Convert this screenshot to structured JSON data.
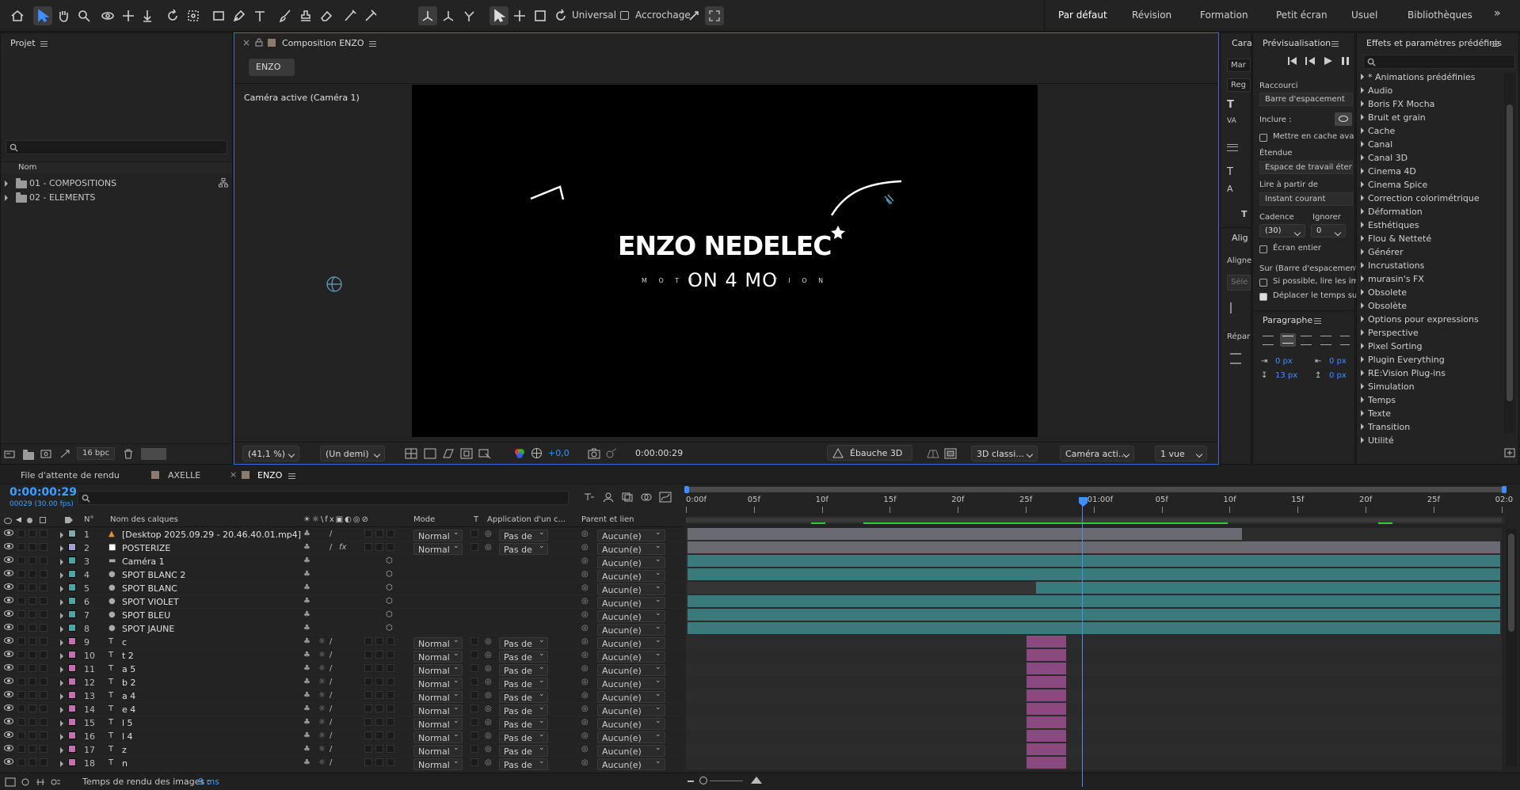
{
  "toolbar": {
    "universal_label": "Universal",
    "snapping_label": "Accrochage",
    "workspaces": [
      "Par défaut",
      "Révision",
      "Formation",
      "Petit écran",
      "Usuel",
      "Bibliothèques"
    ],
    "more": "»"
  },
  "project": {
    "title": "Projet",
    "col_name": "Nom",
    "items": [
      {
        "label": "01 - COMPOSITIONS"
      },
      {
        "label": "02 - ELEMENTS"
      }
    ],
    "bpc": "16 bpc"
  },
  "composition": {
    "close": "×",
    "tab_label": "Composition ENZO",
    "comp_button": "ENZO",
    "camera_label": "Caméra active (Caméra 1)",
    "title_text": "ENZO NEDELEC",
    "subtitle_text": "ON 4 MO",
    "sub_left": "M O T I",
    "sub_right": "T I O N",
    "zoom": "(41,1 %)",
    "resolution": "(Un demi)",
    "exposure": "+0,0",
    "timecode": "0:00:00:29",
    "draft3d": "Ébauche 3D",
    "renderer": "3D classi...",
    "camera_select": "Caméra acti...",
    "views": "1 vue"
  },
  "character_panel": {
    "title": "Cara",
    "font_hint": "Mar",
    "style_hint": "Reg",
    "align_title": "Alig",
    "align_label": "Aligne",
    "select_hint": "Séle",
    "distribute": "Répar"
  },
  "preview": {
    "title": "Prévisualisation",
    "shortcut_label": "Raccourci",
    "shortcut_value": "Barre d'espacement",
    "include_label": "Inclure :",
    "cache_label": "Mettre en cache ava",
    "range_label": "Étendue",
    "range_value": "Espace de travail étend",
    "play_from_label": "Lire à partir de",
    "play_from_value": "Instant courant",
    "framerate_label": "Cadence",
    "skip_label": "Ignorer",
    "framerate_value": "(30)",
    "skip_value": "0",
    "fullscreen_label": "Écran entier",
    "on_label": "Sur (Barre d'espacement",
    "opt1": "Si possible, lire les im",
    "opt2": "Déplacer le temps su",
    "paragraph_title": "Paragraphe",
    "indent_left": "0 px",
    "indent_right": "0 px",
    "space_before": "13 px",
    "space_after": "0 px"
  },
  "effects": {
    "title": "Effets et paramètres prédéfinis",
    "items": [
      "* Animations prédéfinies",
      "Audio",
      "Boris FX Mocha",
      "Bruit et grain",
      "Cache",
      "Canal",
      "Canal 3D",
      "Cinema 4D",
      "Cinema Spice",
      "Correction colorimétrique",
      "Déformation",
      "Esthétiques",
      "Flou & Netteté",
      "Générer",
      "Incrustations",
      "murasin's FX",
      "Obsolete",
      "Obsolète",
      "Options pour expressions",
      "Perspective",
      "Pixel Sorting",
      "Plugin Everything",
      "RE:Vision Plug-ins",
      "Simulation",
      "Temps",
      "Texte",
      "Transition",
      "Utilité"
    ]
  },
  "timeline": {
    "tabs": [
      "File d'attente de rendu",
      "AXELLE",
      "ENZO"
    ],
    "timecode": "0:00:00:29",
    "frame_info": "00029 (30.00 fps)",
    "col_num": "N°",
    "col_name": "Nom des calques",
    "col_mode": "Mode",
    "col_t": "T",
    "col_apply": "Application d'un c...",
    "col_parent": "Parent et lien",
    "ruler": [
      "0:00f",
      "05f",
      "10f",
      "15f",
      "20f",
      "25f",
      "01:00f",
      "05f",
      "10f",
      "15f",
      "20f",
      "25f",
      "02:0"
    ],
    "layers": [
      {
        "n": "1",
        "name": "[Desktop 2025.09.29 - 20.46.40.01.mp4]",
        "color": "#7fa9ad",
        "mode": "Normal",
        "apply": "Pas de",
        "parent": "Aucun(e)",
        "icon": "footage-icon"
      },
      {
        "n": "2",
        "name": "POSTERIZE",
        "color": "#a3a0cf",
        "mode": "Normal",
        "apply": "Pas de",
        "parent": "Aucun(e)",
        "icon": "solid-icon"
      },
      {
        "n": "3",
        "name": "Caméra 1",
        "color": "#4aa7a8",
        "mode": "",
        "apply": "",
        "parent": "Aucun(e)",
        "icon": "camera-icon"
      },
      {
        "n": "4",
        "name": "SPOT BLANC 2",
        "color": "#4aa7a8",
        "mode": "",
        "apply": "",
        "parent": "Aucun(e)",
        "icon": "light-icon"
      },
      {
        "n": "5",
        "name": "SPOT BLANC",
        "color": "#4aa7a8",
        "mode": "",
        "apply": "",
        "parent": "Aucun(e)",
        "icon": "light-icon"
      },
      {
        "n": "6",
        "name": "SPOT VIOLET",
        "color": "#4aa7a8",
        "mode": "",
        "apply": "",
        "parent": "Aucun(e)",
        "icon": "light-icon"
      },
      {
        "n": "7",
        "name": "SPOT BLEU",
        "color": "#4aa7a8",
        "mode": "",
        "apply": "",
        "parent": "Aucun(e)",
        "icon": "light-icon"
      },
      {
        "n": "8",
        "name": "SPOT JAUNE",
        "color": "#4aa7a8",
        "mode": "",
        "apply": "",
        "parent": "Aucun(e)",
        "icon": "light-icon"
      },
      {
        "n": "9",
        "name": "c",
        "color": "#c86fb4",
        "mode": "Normal",
        "apply": "Pas de",
        "parent": "Aucun(e)",
        "icon": "text-icon"
      },
      {
        "n": "10",
        "name": "t 2",
        "color": "#c86fb4",
        "mode": "Normal",
        "apply": "Pas de",
        "parent": "Aucun(e)",
        "icon": "text-icon"
      },
      {
        "n": "11",
        "name": "a 5",
        "color": "#c86fb4",
        "mode": "Normal",
        "apply": "Pas de",
        "parent": "Aucun(e)",
        "icon": "text-icon"
      },
      {
        "n": "12",
        "name": "b 2",
        "color": "#c86fb4",
        "mode": "Normal",
        "apply": "Pas de",
        "parent": "Aucun(e)",
        "icon": "text-icon"
      },
      {
        "n": "13",
        "name": "a 4",
        "color": "#c86fb4",
        "mode": "Normal",
        "apply": "Pas de",
        "parent": "Aucun(e)",
        "icon": "text-icon"
      },
      {
        "n": "14",
        "name": "e 4",
        "color": "#c86fb4",
        "mode": "Normal",
        "apply": "Pas de",
        "parent": "Aucun(e)",
        "icon": "text-icon"
      },
      {
        "n": "15",
        "name": "l 5",
        "color": "#c86fb4",
        "mode": "Normal",
        "apply": "Pas de",
        "parent": "Aucun(e)",
        "icon": "text-icon"
      },
      {
        "n": "16",
        "name": "l 4",
        "color": "#c86fb4",
        "mode": "Normal",
        "apply": "Pas de",
        "parent": "Aucun(e)",
        "icon": "text-icon"
      },
      {
        "n": "17",
        "name": "z",
        "color": "#c86fb4",
        "mode": "Normal",
        "apply": "Pas de",
        "parent": "Aucun(e)",
        "icon": "text-icon"
      },
      {
        "n": "18",
        "name": "n",
        "color": "#c86fb4",
        "mode": "Normal",
        "apply": "Pas de",
        "parent": "Aucun(e)",
        "icon": "text-icon"
      }
    ],
    "status_label": "Temps de rendu des images :",
    "status_value": "9 ms"
  },
  "colors": {
    "accent": "#3f8fff",
    "timecode": "#3f9fff",
    "layer_bar": "#3a7a7c",
    "text_bar": "#8a4a80",
    "video_bar": "#6a6a72"
  }
}
